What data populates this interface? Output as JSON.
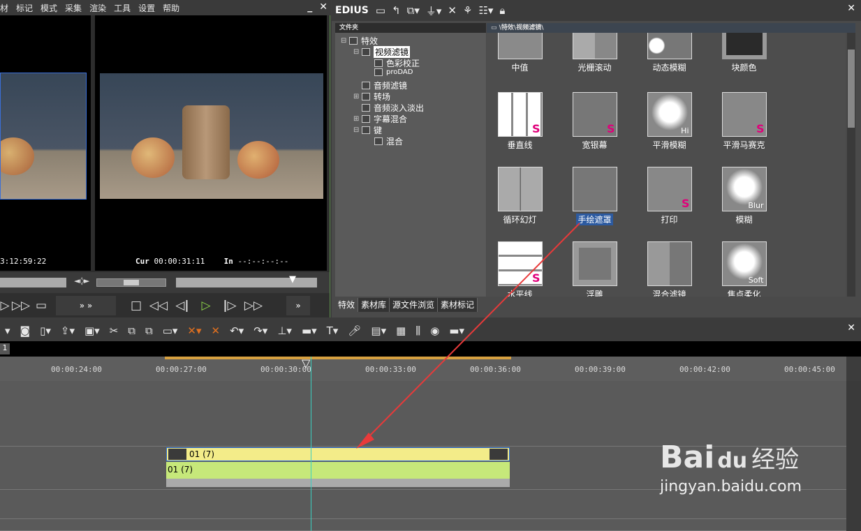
{
  "menu": [
    "材",
    "标记",
    "模式",
    "采集",
    "渲染",
    "工具",
    "设置",
    "帮助"
  ],
  "player": {
    "left_timecode": "3:12:59:22",
    "cur_label": "Cur",
    "cur_timecode": "00:00:31:11",
    "in_label": "In",
    "in_timecode": "--:--:--:--"
  },
  "palette": {
    "title": "EDIUS",
    "folder_header": "文件夹",
    "path_header": "\\特效\\视频滤镜\\",
    "tree": [
      {
        "label": "特效",
        "level": 0
      },
      {
        "label": "视频滤镜",
        "level": 1,
        "selected": true
      },
      {
        "label": "色彩校正",
        "level": 2
      },
      {
        "label": "proDAD",
        "level": 2
      },
      {
        "label": "音频滤镜",
        "level": 1
      },
      {
        "label": "转场",
        "level": 1
      },
      {
        "label": "音频淡入淡出",
        "level": 1
      },
      {
        "label": "字幕混合",
        "level": 1
      },
      {
        "label": "键",
        "level": 1
      },
      {
        "label": "混合",
        "level": 2
      }
    ],
    "effects": [
      {
        "label": "中值",
        "icon": "median-icon"
      },
      {
        "label": "光栅滚动",
        "icon": "raster-scroll-icon"
      },
      {
        "label": "动态模糊",
        "icon": "motion-blur-icon"
      },
      {
        "label": "块颜色",
        "icon": "color-block-icon"
      },
      {
        "label": "垂直线",
        "icon": "vertical-line-icon",
        "badge": "S"
      },
      {
        "label": "宽银幕",
        "icon": "widescreen-icon",
        "badge": "S"
      },
      {
        "label": "平滑模糊",
        "icon": "smooth-blur-icon",
        "badge": "Hi"
      },
      {
        "label": "平滑马赛克",
        "icon": "smooth-mosaic-icon",
        "badge": "S"
      },
      {
        "label": "循环幻灯",
        "icon": "loop-slide-icon"
      },
      {
        "label": "手绘遮罩",
        "icon": "hand-drawn-mask-icon",
        "selected": true
      },
      {
        "label": "打印",
        "icon": "print-icon",
        "badge": "S"
      },
      {
        "label": "模糊",
        "icon": "blur-icon",
        "badge": "Blur"
      },
      {
        "label": "水平线",
        "icon": "horizontal-line-icon",
        "badge": "S"
      },
      {
        "label": "浮雕",
        "icon": "emboss-icon"
      },
      {
        "label": "混合滤镜",
        "icon": "blend-filter-icon"
      },
      {
        "label": "焦点柔化",
        "icon": "focus-soft-icon",
        "badge": "Soft"
      }
    ],
    "tabs": [
      "特效",
      "素材库",
      "源文件浏览",
      "素材标记"
    ]
  },
  "timeline": {
    "sequence_tab": "1",
    "ruler_labels": [
      "00:00:24:00",
      "00:00:27:00",
      "00:00:30:00",
      "00:00:33:00",
      "00:00:36:00",
      "00:00:39:00",
      "00:00:42:00",
      "00:00:45:00"
    ],
    "video_clip": "01 (7)",
    "audio_clip": "01 (7)"
  },
  "watermark": {
    "brand": "Bai",
    "brand2": "经验",
    "url": "jingyan.baidu.com"
  }
}
